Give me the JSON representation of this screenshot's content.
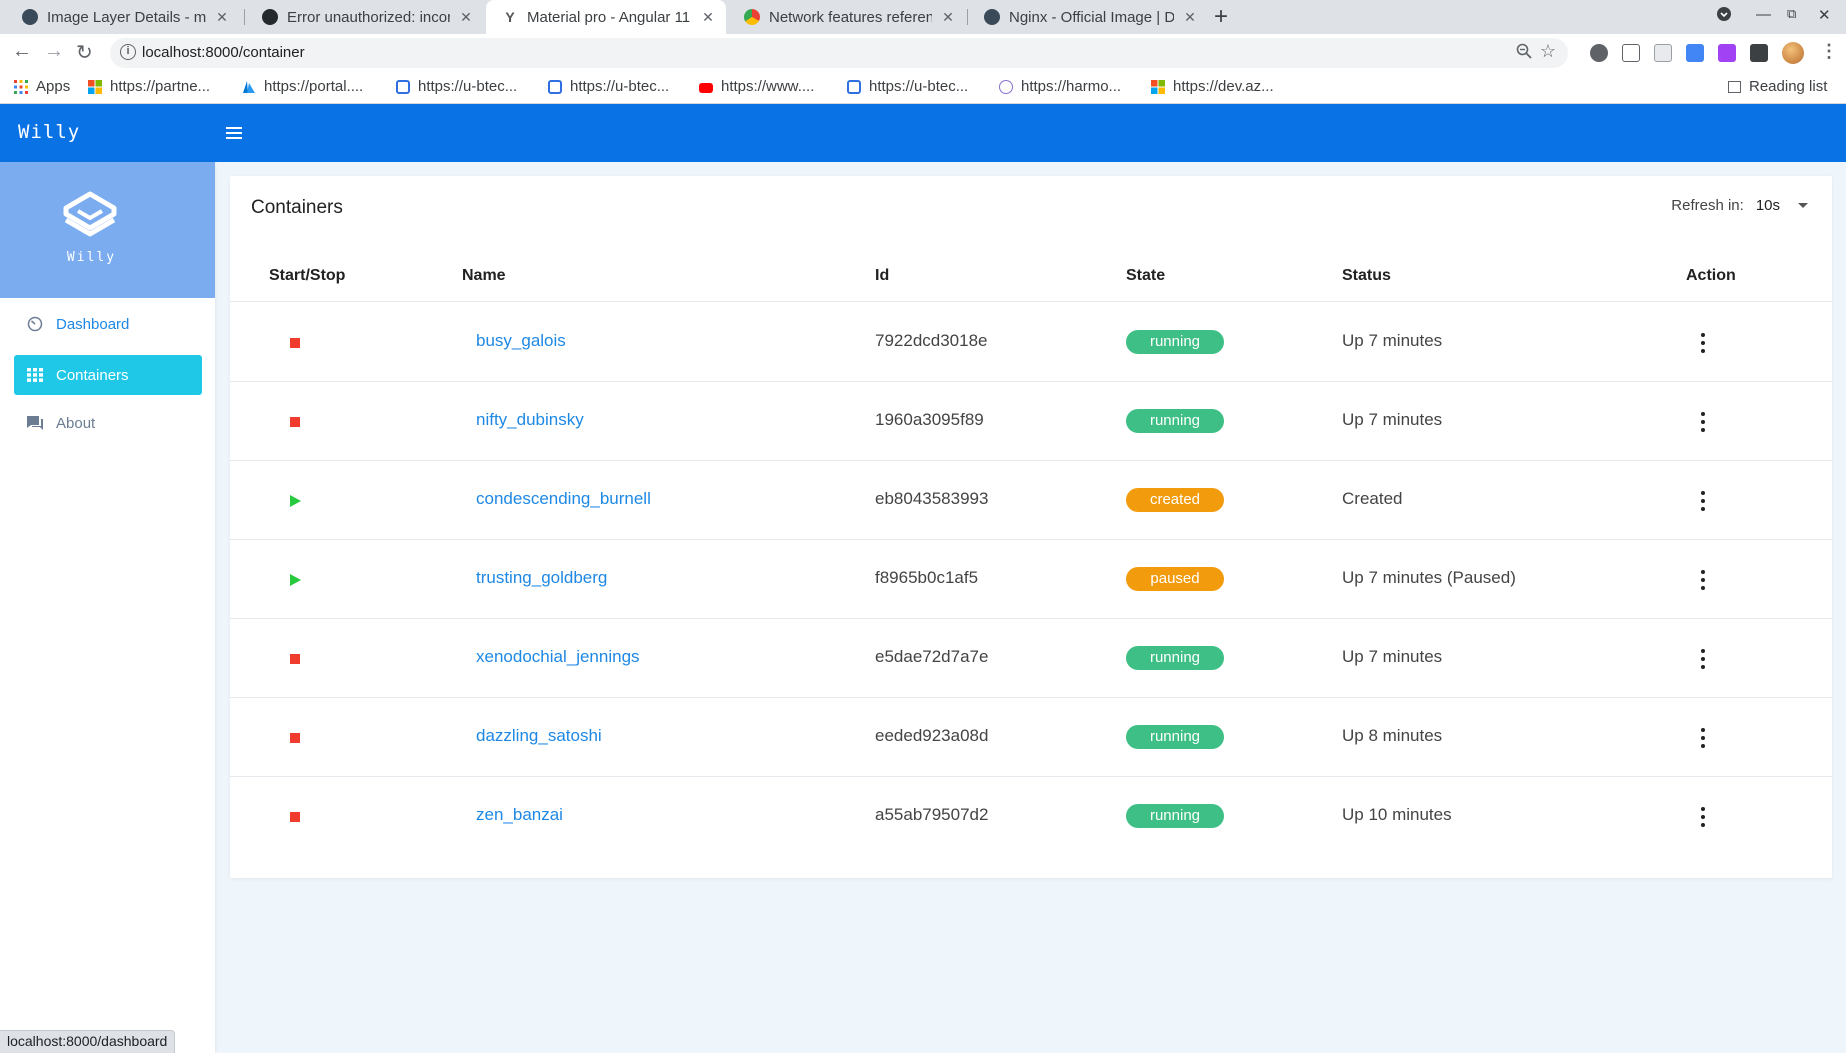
{
  "browser": {
    "tabs": [
      {
        "title": "Image Layer Details - mot"
      },
      {
        "title": "Error unauthorized: incor"
      },
      {
        "title": "Material pro - Angular 11 "
      },
      {
        "title": "Network features referen"
      },
      {
        "title": "Nginx - Official Image | Do"
      }
    ],
    "new_tab": "+",
    "url": "localhost:8000/container",
    "bookmarks": [
      {
        "label": "Apps",
        "color": "#e8453c"
      },
      {
        "label": "https://partne...",
        "color": "#f25022"
      },
      {
        "label": "https://portal....",
        "color": "#0078d4"
      },
      {
        "label": "https://u-btec...",
        "color": "#2f6fe0"
      },
      {
        "label": "https://u-btec...",
        "color": "#2f6fe0"
      },
      {
        "label": "https://www....",
        "color": "#ff0000"
      },
      {
        "label": "https://u-btec...",
        "color": "#2f6fe0"
      },
      {
        "label": "https://harmo...",
        "color": "#8a6fd1"
      },
      {
        "label": "https://dev.az...",
        "color": "#f25022"
      }
    ],
    "reading_list": "Reading list",
    "status_url": "localhost:8000/dashboard"
  },
  "app": {
    "brand": "Willy",
    "logo_text": "Willy",
    "primary_color": "#0972e4",
    "sidebar": {
      "items": [
        {
          "label": "Dashboard",
          "icon": "dashboard-icon"
        },
        {
          "label": "Containers",
          "icon": "grid-icon"
        },
        {
          "label": "About",
          "icon": "chat-icon"
        }
      ]
    }
  },
  "main": {
    "title": "Containers",
    "refresh_label": "Refresh in:",
    "refresh_value": "10s",
    "columns": [
      "Start/Stop",
      "Name",
      "Id",
      "State",
      "Status",
      "Action"
    ],
    "state_colors": {
      "running": "#3dbf85",
      "created": "#f29b0c",
      "paused": "#f29b0c"
    },
    "rows": [
      {
        "control": "stop",
        "name": "busy_galois",
        "id": "7922dcd3018e",
        "state": "running",
        "status": "Up 7 minutes"
      },
      {
        "control": "stop",
        "name": "nifty_dubinsky",
        "id": "1960a3095f89",
        "state": "running",
        "status": "Up 7 minutes"
      },
      {
        "control": "play",
        "name": "condescending_burnell",
        "id": "eb8043583993",
        "state": "created",
        "status": "Created"
      },
      {
        "control": "play",
        "name": "trusting_goldberg",
        "id": "f8965b0c1af5",
        "state": "paused",
        "status": "Up 7 minutes (Paused)"
      },
      {
        "control": "stop",
        "name": "xenodochial_jennings",
        "id": "e5dae72d7a7e",
        "state": "running",
        "status": "Up 7 minutes"
      },
      {
        "control": "stop",
        "name": "dazzling_satoshi",
        "id": "eeded923a08d",
        "state": "running",
        "status": "Up 8 minutes"
      },
      {
        "control": "stop",
        "name": "zen_banzai",
        "id": "a55ab79507d2",
        "state": "running",
        "status": "Up 10 minutes"
      }
    ]
  }
}
